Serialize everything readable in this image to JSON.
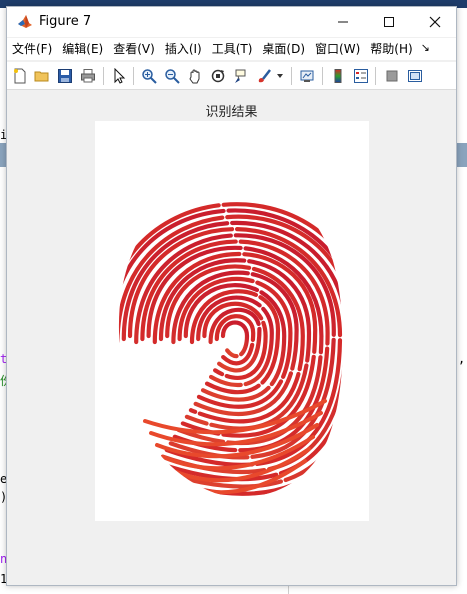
{
  "window": {
    "title": "Figure 7",
    "minimize": "—",
    "maximize": "☐",
    "close": "✕"
  },
  "menu": {
    "items": [
      "文件(F)",
      "编辑(E)",
      "查看(V)",
      "插入(I)",
      "工具(T)",
      "桌面(D)",
      "窗口(W)",
      "帮助(H)"
    ],
    "overflow": "↘"
  },
  "toolbar": {
    "icons": [
      "new-figure-icon",
      "open-file-icon",
      "save-icon",
      "print-icon",
      "pointer-icon",
      "zoom-in-icon",
      "zoom-out-icon",
      "pan-icon",
      "rotate-3d-icon",
      "data-cursor-icon",
      "brush-icon",
      "link-plot-icon",
      "colorbar-icon",
      "legend-icon",
      "hide-tools-icon",
      "show-tools-icon"
    ]
  },
  "axes": {
    "title": "识别结果"
  },
  "background_editor": {
    "fragments": [
      "ic",
      "t",
      "份",
      "e",
      ")",
      "n",
      "1",
      ","
    ]
  },
  "colors": {
    "fingerprint_ridge": "#d42a2a",
    "fingerprint_fill": "#e8492c",
    "figure_bg": "#f0f0f0"
  }
}
